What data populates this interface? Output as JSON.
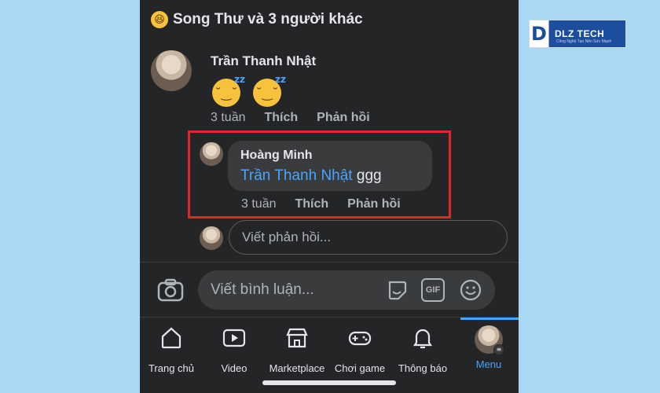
{
  "reactions": {
    "emoji": "😆",
    "text": "Song Thư và 3 người khác"
  },
  "comment": {
    "author": "Trần Thanh Nhật",
    "time": "3 tuần",
    "like_label": "Thích",
    "reply_label": "Phản hồi"
  },
  "reply": {
    "author": "Hoàng Minh",
    "mention": "Trần Thanh Nhật",
    "text": " ggg",
    "time": "3 tuần",
    "like_label": "Thích",
    "reply_label": "Phản hồi"
  },
  "reply_input": {
    "placeholder": "Viết phản hồi..."
  },
  "composer": {
    "placeholder": "Viết bình luận...",
    "gif_label": "GIF"
  },
  "tabs": [
    {
      "label": "Trang chủ",
      "icon": "home-icon"
    },
    {
      "label": "Video",
      "icon": "video-icon"
    },
    {
      "label": "Marketplace",
      "icon": "marketplace-icon"
    },
    {
      "label": "Chơi game",
      "icon": "gaming-icon"
    },
    {
      "label": "Thông báo",
      "icon": "bell-icon"
    },
    {
      "label": "Menu",
      "icon": "menu-avatar-icon",
      "active": true
    }
  ],
  "logo": {
    "name": "DLZ TECH",
    "tagline": "Công Nghệ Tạo Nên Sức Mạnh"
  },
  "colors": {
    "accent": "#4aa3ff",
    "highlight": "#e0262a",
    "background": "#242526",
    "page_bg": "#a9d8f2"
  }
}
